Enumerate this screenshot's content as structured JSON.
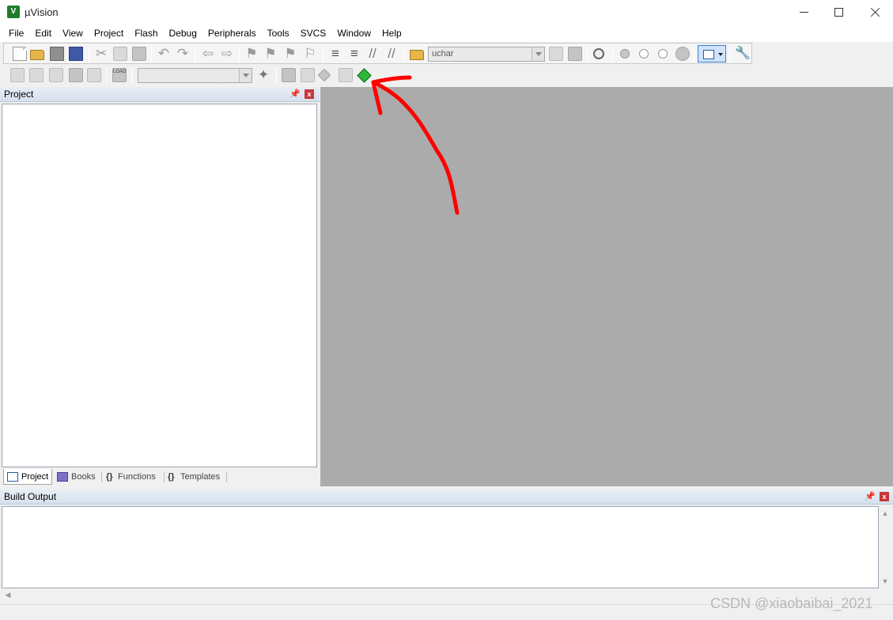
{
  "window": {
    "title": "µVision",
    "logo_text": "V"
  },
  "menu": [
    "File",
    "Edit",
    "View",
    "Project",
    "Flash",
    "Debug",
    "Peripherals",
    "Tools",
    "SVCS",
    "Window",
    "Help"
  ],
  "toolbar": {
    "find_combo_value": "uchar",
    "target_combo_value": ""
  },
  "project_panel": {
    "title": "Project",
    "tabs": [
      {
        "label": "Project",
        "icon": "project-tab-icon",
        "active": true
      },
      {
        "label": "Books",
        "icon": "books-icon"
      },
      {
        "label": "Functions",
        "icon": "functions-icon",
        "prefix": "{}"
      },
      {
        "label": "Templates",
        "icon": "templates-icon",
        "prefix": "{}"
      }
    ]
  },
  "build_output": {
    "title": "Build Output"
  },
  "watermark": "CSDN @xiaobaibai_2021",
  "colors": {
    "editor_bg": "#ababab",
    "annotation": "#ff0000",
    "active_target": "#cfe4fa"
  }
}
